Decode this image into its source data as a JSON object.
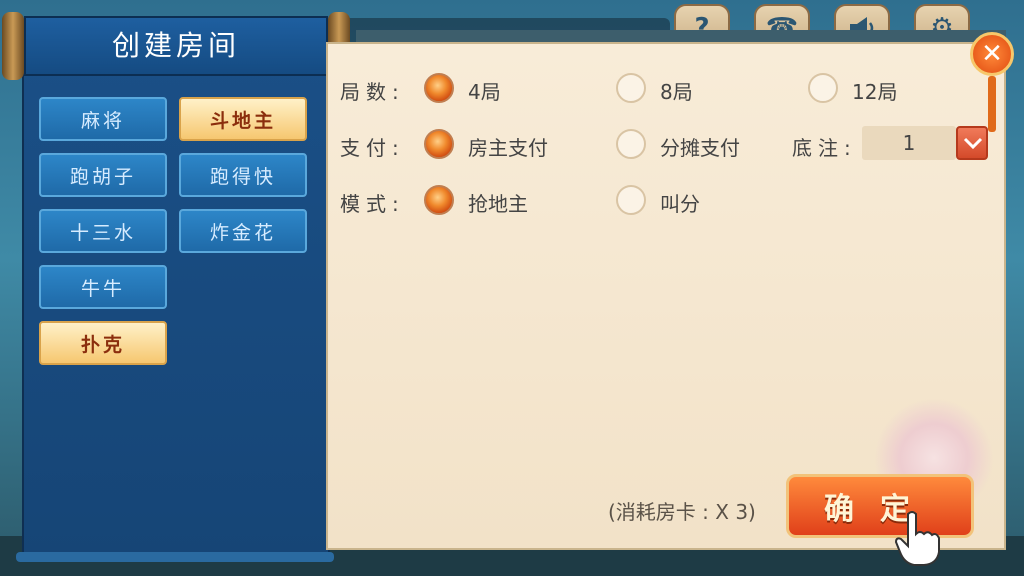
{
  "dialog": {
    "title": "创建房间",
    "close_icon": "close-icon"
  },
  "top_icons": [
    {
      "name": "help-icon",
      "glyph": "?"
    },
    {
      "name": "phone-icon",
      "glyph": "☎"
    },
    {
      "name": "speaker-icon",
      "glyph": "📢"
    },
    {
      "name": "gear-icon",
      "glyph": "⚙"
    }
  ],
  "game_tabs": [
    {
      "label": "麻将",
      "selected": false
    },
    {
      "label": "斗地主",
      "selected": true
    },
    {
      "label": "跑胡子",
      "selected": false
    },
    {
      "label": "跑得快",
      "selected": false
    },
    {
      "label": "十三水",
      "selected": false
    },
    {
      "label": "炸金花",
      "selected": false
    },
    {
      "label": "牛牛",
      "selected": false
    },
    {
      "label": "扑克",
      "selected": true
    }
  ],
  "settings": {
    "rounds": {
      "label": "局数:",
      "options": [
        {
          "label": "4局",
          "selected": true
        },
        {
          "label": "8局",
          "selected": false
        },
        {
          "label": "12局",
          "selected": false
        }
      ]
    },
    "payment": {
      "label": "支付:",
      "options": [
        {
          "label": "房主支付",
          "selected": true
        },
        {
          "label": "分摊支付",
          "selected": false
        }
      ]
    },
    "base_bet": {
      "label": "底注:",
      "value": "1"
    },
    "mode": {
      "label": "模式:",
      "options": [
        {
          "label": "抢地主",
          "selected": true
        },
        {
          "label": "叫分",
          "selected": false
        }
      ]
    }
  },
  "footer": {
    "cost_text": "(消耗房卡 : X 3)",
    "confirm_label": "确定"
  },
  "colors": {
    "panel_blue": "#1a4f86",
    "accent_orange": "#e0401a",
    "paper": "#f8ecd8"
  }
}
